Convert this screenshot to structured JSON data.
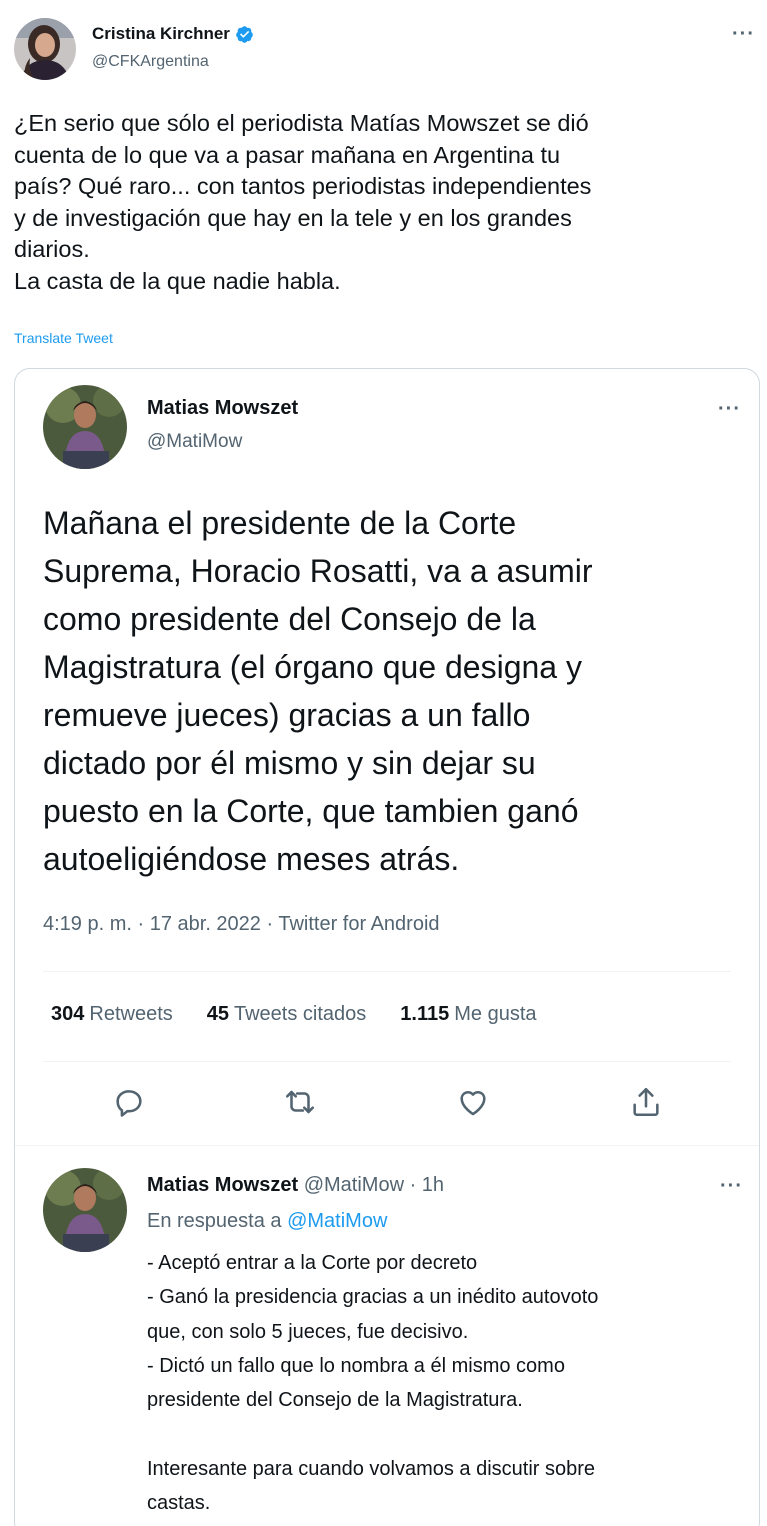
{
  "colors": {
    "accent": "#1d9bf0",
    "text_primary": "#0f1419",
    "text_secondary": "#536471",
    "border": "#cfd9de"
  },
  "outer_tweet": {
    "author_name": "Cristina Kirchner",
    "author_handle": "@CFKArgentina",
    "verified_icon": "verified-badge-icon",
    "more_label": "···",
    "text": "¿En serio que sólo el periodista Matías Mowszet se dió\ncuenta de lo que va a pasar mañana en Argentina tu\npaís? Qué raro... con tantos periodistas independientes\ny de investigación que hay en la tele y en los grandes\ndiarios.\nLa casta de la que nadie habla.",
    "translate_label": "Translate Tweet"
  },
  "quoted_tweet": {
    "author_name": "Matias Mowszet",
    "author_handle": "@MatiMow",
    "more_label": "···",
    "text": "Mañana el presidente de la Corte\nSuprema, Horacio Rosatti, va a asumir\ncomo presidente del Consejo de la\nMagistratura (el órgano que designa y\nremueve jueces) gracias a un fallo\ndictado por él mismo y sin dejar su\npuesto en la Corte, que tambien ganó\nautoeligiéndose meses atrás.",
    "meta": "4:19 p. m. · 17 abr. 2022 · Twitter for Android",
    "stats": {
      "retweets_count": "304",
      "retweets_label": "Retweets",
      "quotes_count": "45",
      "quotes_label": "Tweets citados",
      "likes_count": "1.115",
      "likes_label": "Me gusta"
    },
    "actions": [
      "reply-icon",
      "retweet-icon",
      "like-icon",
      "share-icon"
    ]
  },
  "reply_tweet": {
    "author_name": "Matias Mowszet",
    "author_handle_time": "@MatiMow · 1h",
    "more_label": "···",
    "replying_prefix": "En respuesta a",
    "replying_mention": "@MatiMow",
    "text": "- Aceptó entrar a la Corte por decreto\n- Ganó la presidencia gracias a un inédito autovoto\nque, con solo 5 jueces, fue decisivo.\n- Dictó un fallo que lo nombra a él mismo como\npresidente del Consejo de la Magistratura.\n\nInteresante para cuando volvamos a discutir sobre\ncastas."
  }
}
